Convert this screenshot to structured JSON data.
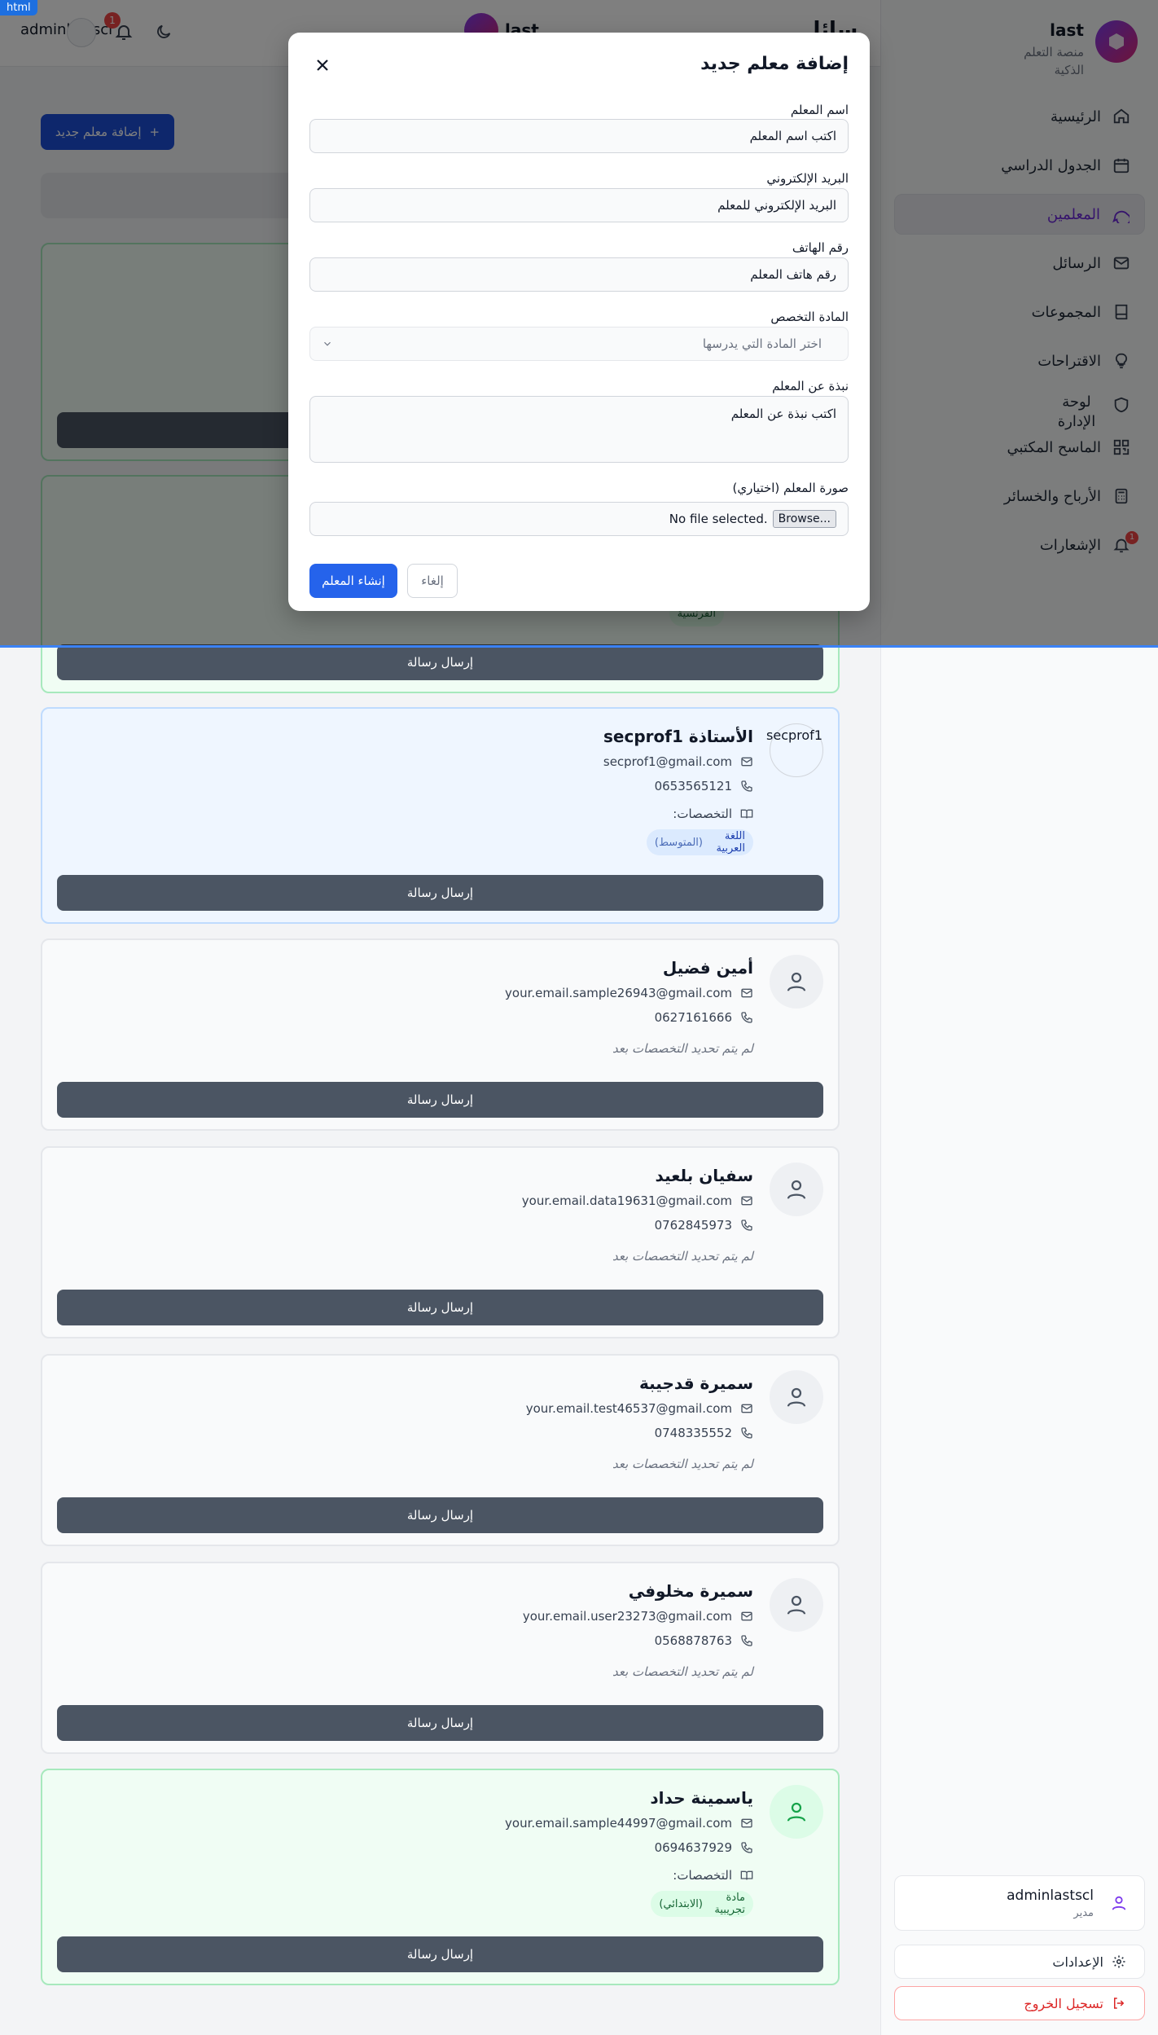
{
  "html_tag": "html",
  "brand": {
    "title": "last",
    "subtitle": "منصة التعلم الذكية"
  },
  "nav": [
    {
      "label": "الرئيسية",
      "icon": "home-icon"
    },
    {
      "label": "الجدول الدراسي",
      "icon": "calendar-icon"
    },
    {
      "label": "المعلمين",
      "icon": "chat-bubble-icon",
      "active": true
    },
    {
      "label": "الرسائل",
      "icon": "mail-icon"
    },
    {
      "label": "المجموعات",
      "icon": "book-icon"
    },
    {
      "label": "الاقتراحات",
      "icon": "lightbulb-icon"
    },
    {
      "label": "لوحة الإدارة",
      "icon": "shield-icon"
    },
    {
      "label": "الماسح المكتبي",
      "icon": "qr-icon"
    },
    {
      "label": "الأرباح والخسائر",
      "icon": "calculator-icon"
    },
    {
      "label": "الإشعارات",
      "icon": "bell-icon",
      "badge": "1"
    }
  ],
  "user": {
    "name": "adminlastscl",
    "role": "مدير"
  },
  "settings_label": "الإعدادات",
  "logout_label": "تسجيل الخروج",
  "header": {
    "username": "adminlastscl",
    "bell_badge": "1",
    "center_title": "last",
    "page_title_partial": "الرسائل"
  },
  "add_teacher_label": "إضافة معلم جديد",
  "modal": {
    "title": "إضافة معلم جديد",
    "name_label": "اسم المعلم",
    "name_placeholder": "اكتب اسم المعلم",
    "email_label": "البريد الإلكتروني",
    "email_placeholder": "البريد الإلكتروني للمعلم",
    "phone_label": "رقم الهاتف",
    "phone_placeholder": "رقم هاتف المعلم",
    "subject_label": "المادة التخصص",
    "subject_placeholder": "اختر المادة التي يدرسها",
    "bio_label": "نبذة عن المعلم",
    "bio_placeholder": "اكتب نبذة عن المعلم",
    "photo_label": "صورة المعلم (اختياري)",
    "browse_label": "Browse...",
    "no_file": "No file selected.",
    "create_label": "إنشاء المعلم",
    "cancel_label": "إلغاء"
  },
  "partial_chip": "الفرنسية",
  "send_message_label": "إرسال رسالة",
  "specs_label": "التخصصات:",
  "no_specs": "لم يتم تحديد التخصصات بعد",
  "teachers": [
    {
      "name": "الأستاذة secprof1",
      "avatar_text": "secprof1",
      "email": "secprof1@gmail.com",
      "phone": "0653565121",
      "chip_main": "اللغة العربية",
      "chip_level": "(المتوسط)"
    },
    {
      "name": "أمين فضيل",
      "email": "your.email.sample26943@gmail.com",
      "phone": "0627161666"
    },
    {
      "name": "سفيان بلعيد",
      "email": "your.email.data19631@gmail.com",
      "phone": "0762845973"
    },
    {
      "name": "سميرة قدجيبة",
      "email": "your.email.test46537@gmail.com",
      "phone": "0748335552"
    },
    {
      "name": "سميرة مخلوفي",
      "email": "your.email.user23273@gmail.com",
      "phone": "0568878763"
    },
    {
      "name": "ياسمينة حداد",
      "email": "your.email.sample44997@gmail.com",
      "phone": "0694637929",
      "chip_main": "مادة تجريبية",
      "chip_level": "(الابتدائي)"
    }
  ]
}
